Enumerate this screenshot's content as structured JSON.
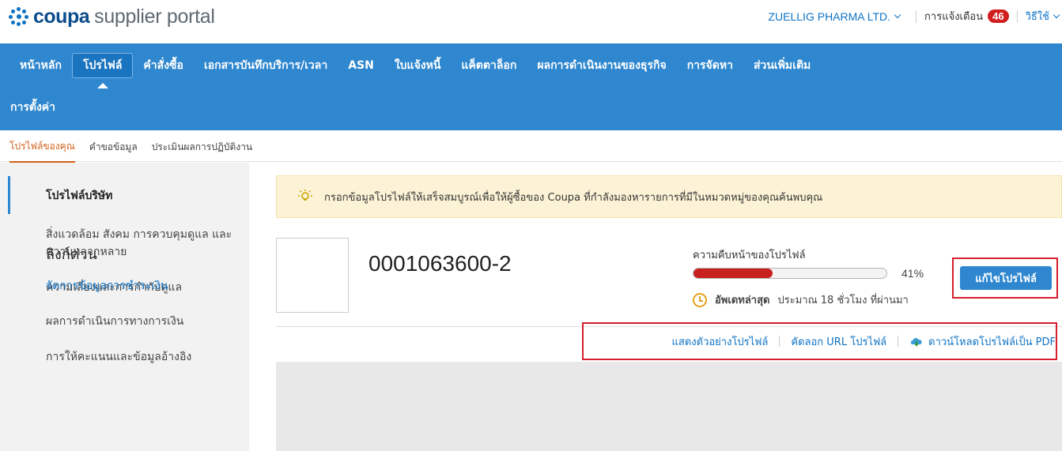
{
  "header": {
    "brand": "coupa",
    "product": "supplier portal",
    "company": "ZUELLIG PHARMA LTD.",
    "notifications_label": "การแจ้งเตือน",
    "notifications_count": "46",
    "help_label": "วิธีใช้"
  },
  "nav": {
    "items": [
      {
        "label": "หน้าหลัก"
      },
      {
        "label": "โปรไฟล์"
      },
      {
        "label": "คำสั่งซื้อ"
      },
      {
        "label": "เอกสารบันทึกบริการ/เวลา"
      },
      {
        "label": "ASN"
      },
      {
        "label": "ใบแจ้งหนี้"
      },
      {
        "label": "แค็ตตาล็อก"
      },
      {
        "label": "ผลการดำเนินงานของธุรกิจ"
      },
      {
        "label": "การจัดหา"
      },
      {
        "label": "ส่วนเพิ่มเติม"
      },
      {
        "label": "การตั้งค่า"
      }
    ],
    "active_index": 1
  },
  "subnav": {
    "items": [
      {
        "label": "โปรไฟล์ของคุณ"
      },
      {
        "label": "คำขอข้อมูล"
      },
      {
        "label": "ประเมินผลการปฏิบัติงาน"
      }
    ]
  },
  "sidebar": {
    "items": [
      {
        "label": "โปรไฟล์บริษัท"
      },
      {
        "label": "สิ่งแวดล้อม สังคม การควบคุมดูแล และความหลากหลาย"
      },
      {
        "label": "ความเสี่ยงและการกำกับดูแล"
      },
      {
        "label": "ผลการดำเนินการทางการเงิน"
      },
      {
        "label": "การให้คะแนนและข้อมูลอ้างอิง"
      }
    ],
    "quick_links_heading": "ลิงก์ด่วน",
    "quick_link": "จัดการข้อมูลการชำระเงิน"
  },
  "tip": {
    "text": "กรอกข้อมูลโปรไฟล์ให้เสร็จสมบูรณ์เพื่อให้ผู้ซื้อของ Coupa ที่กำลังมองหารายการที่มีในหมวดหมู่ของคุณค้นพบคุณ"
  },
  "profile": {
    "supplier_id": "0001063600-2",
    "progress_title": "ความคืบหน้าของโปรไฟล์",
    "progress_value": 41,
    "progress_text": "41%",
    "updated_label": "อัพเดทล่าสุด",
    "updated_value": "ประมาณ 18 ชั่วโมง ที่ผ่านมา",
    "edit_button": "แก้ไขโปรไฟล์"
  },
  "links": {
    "preview": "แสดงตัวอย่างโปรไฟล์",
    "copy_url": "คัดลอก URL โปรไฟล์",
    "download_pdf": "ดาวน์โหลดโปรไฟล์เป็น PDF"
  },
  "colors": {
    "nav_blue": "#2e87cf",
    "brand_blue": "#0b4d8b",
    "accent_orange": "#d2611b",
    "badge_red": "#d11f1f",
    "progress_red": "#c81f1f",
    "highlight_red": "#d61f2c"
  }
}
